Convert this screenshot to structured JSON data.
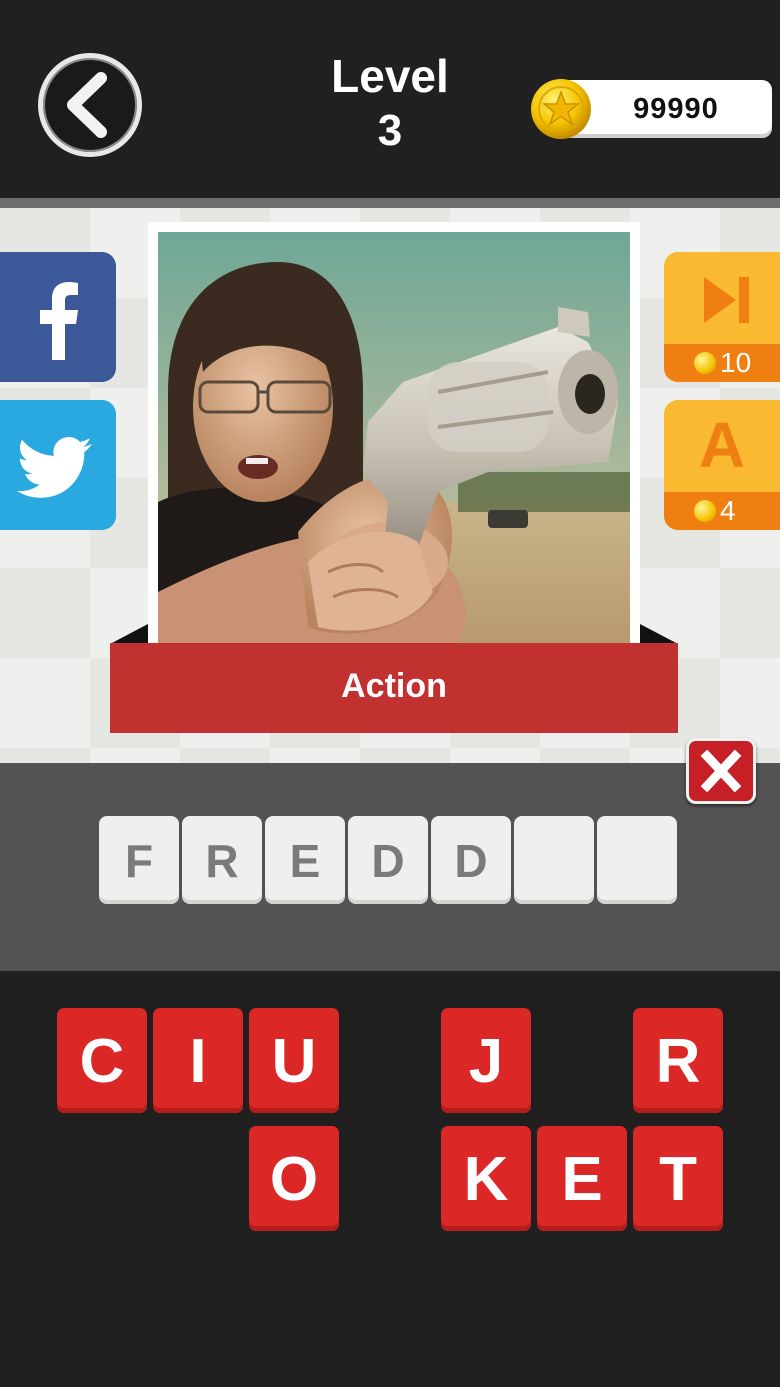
{
  "header": {
    "level_label": "Level",
    "level_number": "3",
    "coins": "99990"
  },
  "icons": {
    "back": "chevron-left-icon",
    "coin": "star-coin-icon",
    "facebook": "facebook-icon",
    "twitter": "twitter-icon",
    "skip": "skip-forward-icon",
    "clear": "close-icon"
  },
  "hints": {
    "skip_cost": "10",
    "reveal_letter": "A",
    "reveal_cost": "4"
  },
  "puzzle": {
    "category": "Action",
    "answer_slots": [
      "F",
      "R",
      "E",
      "D",
      "D",
      "",
      ""
    ]
  },
  "letter_pool": {
    "row1": [
      "C",
      "I",
      "U",
      "",
      "J",
      "",
      "R"
    ],
    "row2": [
      "",
      "",
      "O",
      "",
      "K",
      "E",
      "T"
    ]
  },
  "colors": {
    "tile_red": "#dc2727",
    "category_red": "#c0312f",
    "hint_yellow": "#f9b930",
    "hint_orange": "#f07f12",
    "facebook_blue": "#3b5998",
    "twitter_blue": "#2aa9e0"
  }
}
